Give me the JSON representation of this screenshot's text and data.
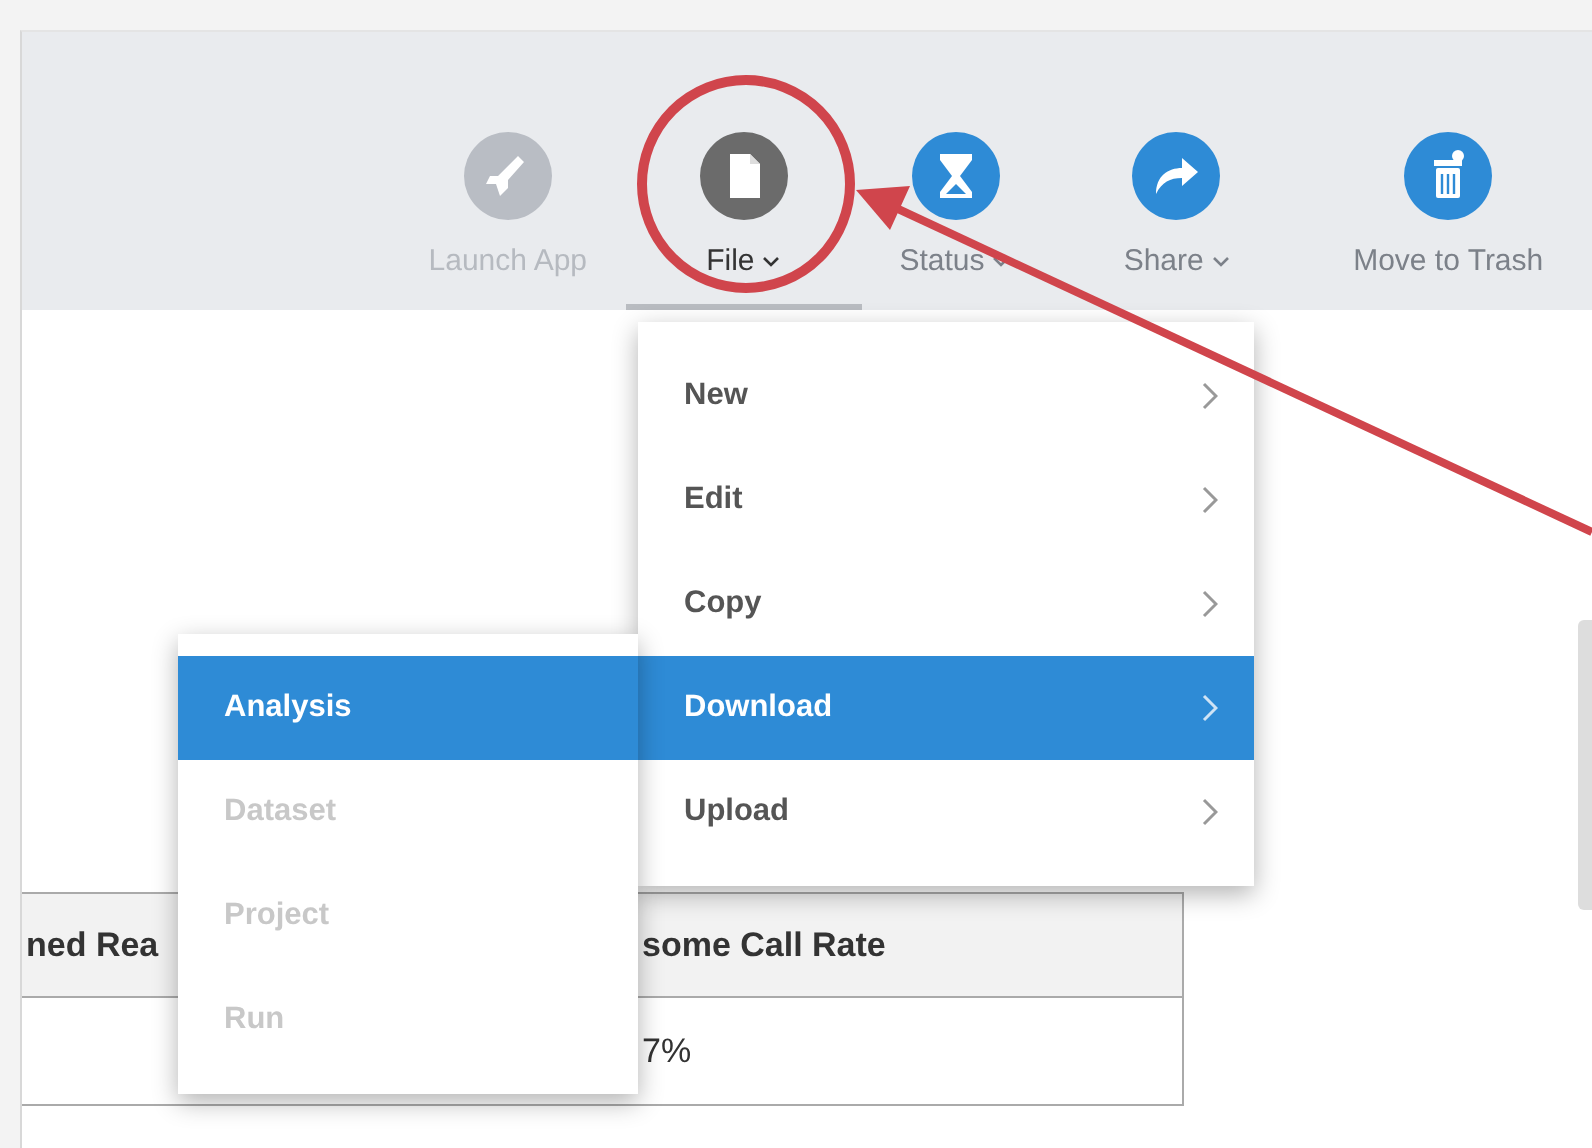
{
  "toolbar": [
    {
      "label": "Launch App",
      "kind": "rocket",
      "disabled": true,
      "selected": false,
      "dropdown": false
    },
    {
      "label": "File",
      "kind": "file",
      "disabled": false,
      "selected": true,
      "dropdown": true
    },
    {
      "label": "Status",
      "kind": "hourglass",
      "disabled": false,
      "selected": false,
      "dropdown": true
    },
    {
      "label": "Share",
      "kind": "share",
      "disabled": false,
      "selected": false,
      "dropdown": true
    },
    {
      "label": "Move to Trash",
      "kind": "trash",
      "disabled": false,
      "selected": false,
      "dropdown": false
    }
  ],
  "file_menu": [
    {
      "label": "New",
      "selected": false
    },
    {
      "label": "Edit",
      "selected": false
    },
    {
      "label": "Copy",
      "selected": false
    },
    {
      "label": "Download",
      "selected": true
    },
    {
      "label": "Upload",
      "selected": false
    }
  ],
  "download_submenu": [
    {
      "label": "Analysis",
      "selected": true,
      "disabled": false
    },
    {
      "label": "Dataset",
      "selected": false,
      "disabled": true
    },
    {
      "label": "Project",
      "selected": false,
      "disabled": true
    },
    {
      "label": "Run",
      "selected": false,
      "disabled": true
    }
  ],
  "table": {
    "columns": [
      "ned Rea",
      "some Call Rate"
    ],
    "rows": [
      [
        "",
        "7%"
      ]
    ]
  }
}
